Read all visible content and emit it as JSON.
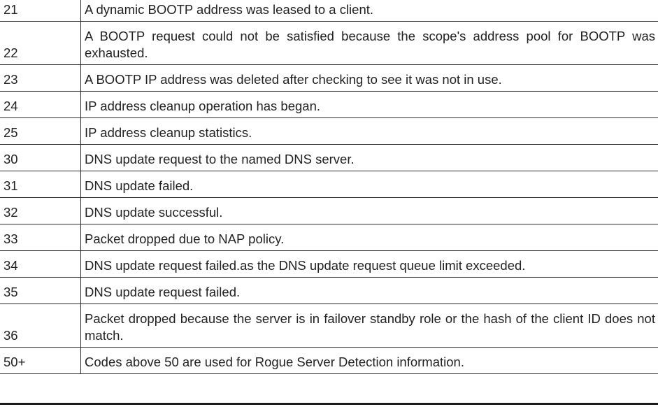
{
  "rows": [
    {
      "id": "21",
      "description": "A dynamic BOOTP address was leased to a client."
    },
    {
      "id": "22",
      "description": "A BOOTP request could not be satisfied because the scope's address pool for BOOTP was exhausted."
    },
    {
      "id": "23",
      "description": "A BOOTP IP address was deleted after checking to see it was not in use."
    },
    {
      "id": "24",
      "description": "IP address cleanup operation has began."
    },
    {
      "id": "25",
      "description": "IP address cleanup statistics."
    },
    {
      "id": "30",
      "description": "DNS update request to the named DNS server."
    },
    {
      "id": "31",
      "description": "DNS update failed."
    },
    {
      "id": "32",
      "description": "DNS update successful."
    },
    {
      "id": "33",
      "description": "Packet dropped due to NAP policy."
    },
    {
      "id": "34",
      "description": "DNS update request failed.as the DNS update request queue limit exceeded."
    },
    {
      "id": "35",
      "description": "DNS update request failed."
    },
    {
      "id": "36",
      "description": "Packet dropped because the server is in failover standby role or the hash of the client ID does not match."
    },
    {
      "id": "50+",
      "description": "Codes above 50 are used for Rogue Server Detection information."
    }
  ]
}
